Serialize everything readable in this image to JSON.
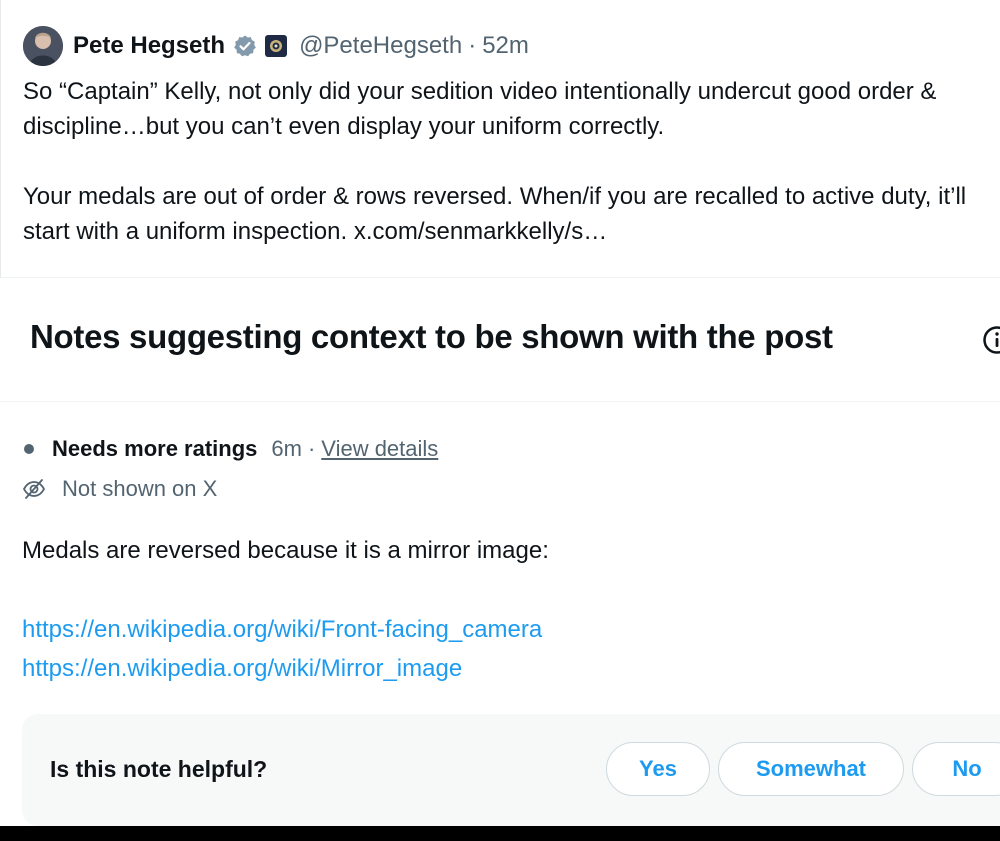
{
  "post": {
    "author_name": "Pete Hegseth",
    "handle": "@PeteHegseth",
    "separator": "·",
    "time": "52m",
    "paragraph_1": "So “Captain” Kelly, not only did your sedition video intentionally undercut good order & discipline…but you can’t even display your uniform correctly.",
    "paragraph_2_text": "Your medals are out of order & rows reversed. When/if you are recalled to active duty, it’ll start with a uniform inspection. ",
    "paragraph_2_link": "x.com/senmarkkelly/s…",
    "icons": {
      "avatar": "avatar-photo",
      "verified": "verified-badge-icon",
      "affiliation": "affiliation-badge-icon"
    }
  },
  "notes_section": {
    "title": "Notes suggesting context to be shown with the post",
    "info_icon": "info-icon"
  },
  "note": {
    "status": "Needs more ratings",
    "age": "6m",
    "separator": "·",
    "view_details": "View details",
    "visibility": "Not shown on X",
    "body": "Medals are reversed because it is a mirror image:",
    "links": [
      "https://en.wikipedia.org/wiki/Front-facing_camera",
      "https://en.wikipedia.org/wiki/Mirror_image"
    ]
  },
  "rating": {
    "question": "Is this note helpful?",
    "yes": "Yes",
    "somewhat": "Somewhat",
    "no": "No"
  },
  "colors": {
    "text_primary": "#0f1419",
    "text_secondary": "#536471",
    "link_blue": "#1d9bf0",
    "panel_bg": "#f7f9f9",
    "border": "#cfd9de"
  }
}
